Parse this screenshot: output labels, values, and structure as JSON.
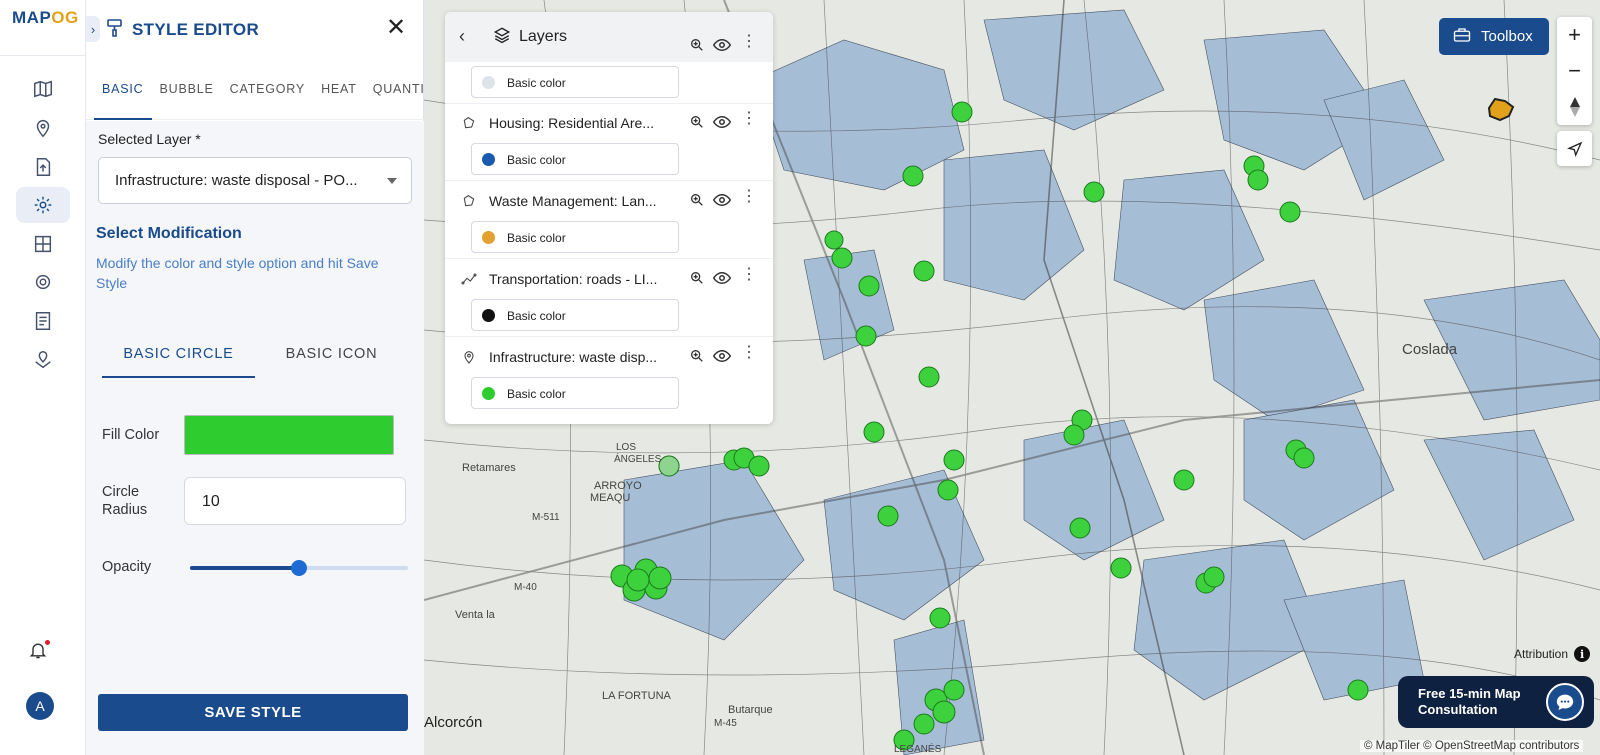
{
  "app": {
    "logo_main": "MAP",
    "logo_accent": "OG"
  },
  "editor": {
    "title": "STYLE EDITOR",
    "tabs": [
      "BASIC",
      "BUBBLE",
      "CATEGORY",
      "HEAT",
      "QUANTITY"
    ],
    "selected_layer_label": "Selected Layer *",
    "selected_layer_value": "Infrastructure: waste disposal - PO...",
    "modification_title": "Select Modification",
    "modification_desc": "Modify the color and style option and hit Save Style",
    "style_tabs": [
      "BASIC CIRCLE",
      "BASIC ICON"
    ],
    "fill_color_label": "Fill Color",
    "fill_color": "#2ecc2e",
    "circle_radius_label": "Circle Radius",
    "circle_radius_value": "10",
    "opacity_label": "Opacity",
    "opacity_fraction": 0.5,
    "save_label": "SAVE STYLE"
  },
  "avatar_letter": "A",
  "layers": {
    "title": "Layers",
    "items": [
      {
        "name": "",
        "color_label": "Basic color",
        "color": "#dde3ea"
      },
      {
        "name": "Housing: Residential Are...",
        "color_label": "Basic color",
        "color": "#1a5bb0"
      },
      {
        "name": "Waste Management: Lan...",
        "color_label": "Basic color",
        "color": "#e2a030"
      },
      {
        "name": "Transportation: roads - LI...",
        "color_label": "Basic color",
        "color": "#111111"
      },
      {
        "name": "Infrastructure: waste disp...",
        "color_label": "Basic color",
        "color": "#2ecc2e"
      }
    ]
  },
  "map": {
    "place_names": [
      "Coslada",
      "Retamares",
      "ARROYO",
      "MEAQU",
      "M-511",
      "Venta la",
      "LA FORTUNA",
      "Butarque",
      "M-45",
      "Alcorcón",
      "M-40",
      "LOS",
      "ÁNGELES",
      "LEGANÉS"
    ],
    "toolbox_label": "Toolbox",
    "attribution_label": "Attribution",
    "consult_line1": "Free 15-min Map",
    "consult_line2": "Consultation",
    "copyright": "© MapTiler © OpenStreetMap contributors"
  }
}
